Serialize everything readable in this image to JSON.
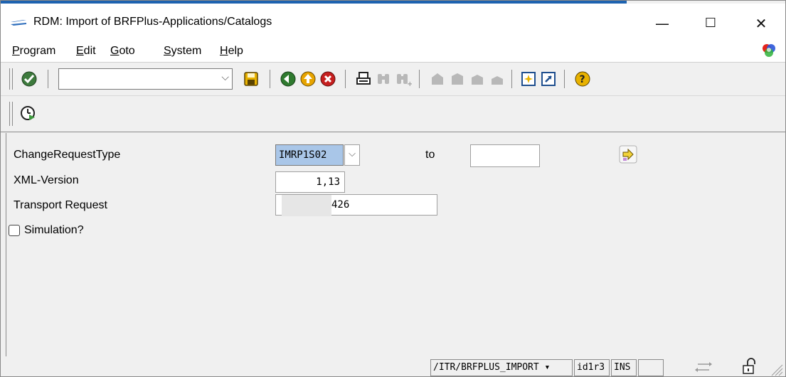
{
  "window": {
    "title": "RDM: Import of BRFPlus-Applications/Catalogs",
    "minimize_symbol": "—",
    "maximize_symbol": "☐",
    "close_symbol": "✕"
  },
  "menu": {
    "items": [
      {
        "u": "P",
        "rest": "rogram"
      },
      {
        "u": "E",
        "rest": "dit"
      },
      {
        "u": "G",
        "rest": "oto"
      },
      {
        "u": "S",
        "rest": "ystem"
      },
      {
        "u": "H",
        "rest": "elp"
      }
    ]
  },
  "toolbar": {
    "command_field_value": "",
    "command_dropdown_symbol": "⌵"
  },
  "form": {
    "change_request_type_label": "ChangeRequestType",
    "change_request_type_value": "IMRP1S02",
    "dropdown_symbol": "⌵",
    "to_label": "to",
    "to_value": "",
    "xml_version_label": "XML-Version",
    "xml_version_value": "1,13",
    "transport_request_label": "Transport Request",
    "transport_request_value": "426",
    "simulation_label": "Simulation?",
    "simulation_checked": false
  },
  "status": {
    "transaction": "/ITR/BRFPLUS_IMPORT",
    "transaction_dropdown_symbol": "▾",
    "system": "id1r3",
    "mode": "INS"
  },
  "colors": {
    "accent": "#1e63b0",
    "selection": "#a9c6e8",
    "window_bg": "#f0f0f0"
  }
}
